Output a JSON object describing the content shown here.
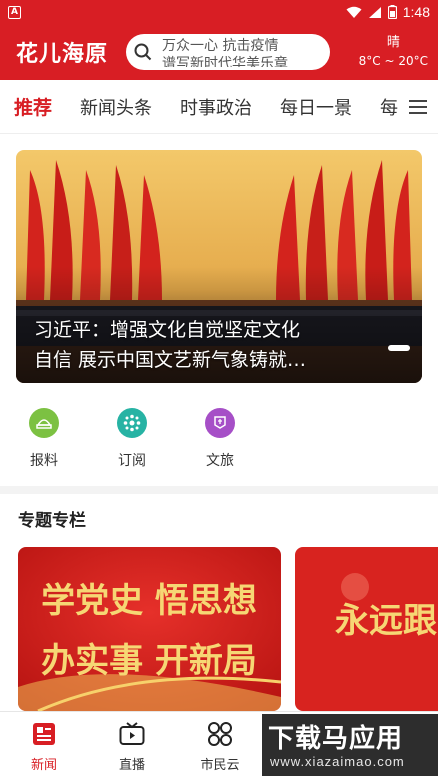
{
  "status_bar": {
    "app_badge": "A",
    "time": "1:48"
  },
  "header": {
    "logo": "花儿海原",
    "search_line1": "万众一心 抗击疫情",
    "search_line2": "谱写新时代华美乐章",
    "weather_condition": "晴",
    "weather_temp": "8°C ~ 20°C",
    "brand_color": "#d81e24"
  },
  "tabs": [
    {
      "label": "推荐",
      "active": true
    },
    {
      "label": "新闻头条",
      "active": false
    },
    {
      "label": "时事政治",
      "active": false
    },
    {
      "label": "每日一景",
      "active": false
    },
    {
      "label": "每",
      "active": false
    }
  ],
  "banner": {
    "caption_line1": "习近平：增强文化自觉坚定文化",
    "caption_line2": "自信 展示中国文艺新气象铸就…"
  },
  "quick_links": [
    {
      "label": "报料",
      "icon": "report-icon",
      "color": "#7cc142"
    },
    {
      "label": "订阅",
      "icon": "subscribe-icon",
      "color": "#27b3a4"
    },
    {
      "label": "文旅",
      "icon": "culture-travel-icon",
      "color": "#a64fc7"
    }
  ],
  "section": {
    "title": "专题专栏"
  },
  "topics": [
    {
      "text_line1": "学党史 悟思想",
      "text_line2": "办实事 开新局"
    },
    {
      "text_line1": "永远跟"
    }
  ],
  "bottom_nav": [
    {
      "label": "新闻",
      "icon": "news-icon",
      "active": true
    },
    {
      "label": "直播",
      "icon": "tv-icon",
      "active": false
    },
    {
      "label": "市民云",
      "icon": "cloud-grid-icon",
      "active": false
    }
  ],
  "watermark": {
    "main": "下载马应用",
    "sub": "www.xiazaimao.com"
  }
}
